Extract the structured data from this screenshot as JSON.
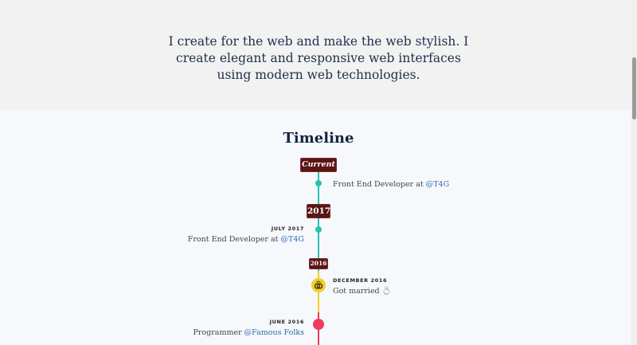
{
  "hero": {
    "intro": "I create for the web and make the web stylish. I create elegant and responsive web interfaces using modern web technologies."
  },
  "timeline": {
    "title": "Timeline",
    "tags": {
      "current": "Current",
      "y2017": "2017",
      "y2016": "2016"
    },
    "entries": [
      {
        "date": "",
        "text": "Front End Developer at ",
        "link": "@T4G",
        "side": "right",
        "dot_color": "#2cc2b0"
      },
      {
        "date": "JULY 2017",
        "text": "Front End Developer at ",
        "link": "@T4G",
        "side": "left",
        "dot_color": "#2cc2b0"
      },
      {
        "date": "DECEMBER 2016",
        "text": "Got married 💍",
        "link": "",
        "side": "right",
        "dot_color": "#f2cf2a",
        "dot_icon": "rings-icon"
      },
      {
        "date": "JUNE 2016",
        "text": "Programmer ",
        "link": "@Famous Folks",
        "side": "left",
        "dot_color": "#ef3b5f"
      }
    ]
  },
  "colors": {
    "tag_bg": "#5a1515",
    "line_teal": "#2cc2b0",
    "line_yellow": "#f2cf2a",
    "line_red": "#ef3b5f",
    "link": "#2a6bb0"
  }
}
